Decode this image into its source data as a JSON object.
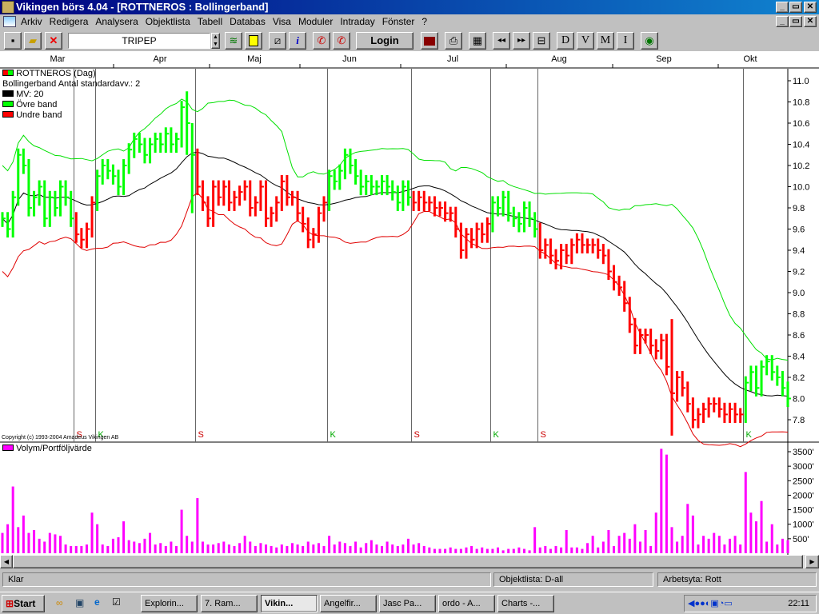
{
  "window": {
    "title": "Vikingen börs 4.04 - [ROTTNEROS : Bollingerband]",
    "min": "_",
    "restore": "▭",
    "close": "✕"
  },
  "menu": [
    "Arkiv",
    "Redigera",
    "Analysera",
    "Objektlista",
    "Tabell",
    "Databas",
    "Visa",
    "Moduler",
    "Intraday",
    "Fönster",
    "?"
  ],
  "toolbar": {
    "ticker": "TRIPEP",
    "login": "Login",
    "period_buttons": [
      "D",
      "V",
      "M",
      "I"
    ]
  },
  "chart": {
    "legend": {
      "title": "ROTTNEROS (Dag)",
      "subtitle": "Bollingerband  Antal standardavv.: 2",
      "ma": "MV: 20",
      "upper": "Övre band",
      "lower": "Undre band"
    },
    "copyright": "Copyright (c) 1993-2004 Amadeus Vikingen AB",
    "volume_label": "Volym/Portföljvärde"
  },
  "chart_data": {
    "type": "bar",
    "months": [
      "Mar",
      "Apr",
      "Maj",
      "Jun",
      "Jul",
      "Aug",
      "Sep",
      "Okt"
    ],
    "ylim": [
      7.6,
      11.12
    ],
    "yticks": [
      "11.0",
      "10.8",
      "10.6",
      "10.4",
      "10.2",
      "10.0",
      "9.8",
      "9.6",
      "9.4",
      "9.2",
      "9.0",
      "8.8",
      "8.6",
      "8.4",
      "8.2",
      "8.0",
      "7.8"
    ],
    "close": [
      9.7,
      9.6,
      9.9,
      10.3,
      10.2,
      9.8,
      9.9,
      10.0,
      9.7,
      9.9,
      9.8,
      10.0,
      9.9,
      9.7,
      9.55,
      9.5,
      9.6,
      9.85,
      10.1,
      10.2,
      10.15,
      10.1,
      10.0,
      10.2,
      10.35,
      10.45,
      10.4,
      10.3,
      10.4,
      10.45,
      10.4,
      10.5,
      10.4,
      10.45,
      10.75,
      10.6,
      10.3,
      10.0,
      9.85,
      9.7,
      10.0,
      9.9,
      10.0,
      9.85,
      9.9,
      9.95,
      10.0,
      9.8,
      9.85,
      10.0,
      9.7,
      9.75,
      9.85,
      10.05,
      9.9,
      9.9,
      9.75,
      9.65,
      9.5,
      9.55,
      9.75,
      9.85,
      10.1,
      10.05,
      10.15,
      10.3,
      10.2,
      10.1,
      10.0,
      10.05,
      10.0,
      10.0,
      10.05,
      10.0,
      9.95,
      9.85,
      10.0,
      9.9,
      9.85,
      9.9,
      9.85,
      9.85,
      9.8,
      9.8,
      9.75,
      9.75,
      9.6,
      9.4,
      9.55,
      9.5,
      9.6,
      9.55,
      9.65,
      9.85,
      9.8,
      9.9,
      9.75,
      9.7,
      9.65,
      9.8,
      9.7,
      9.6,
      9.4,
      9.45,
      9.35,
      9.3,
      9.4,
      9.35,
      9.45,
      9.5,
      9.45,
      9.45,
      9.45,
      9.4,
      9.35,
      9.2,
      9.1,
      9.05,
      8.9,
      8.7,
      8.5,
      8.6,
      8.6,
      8.5,
      8.45,
      8.55,
      8.3,
      8.05,
      8.2,
      8.1,
      7.95,
      7.8,
      7.85,
      7.9,
      7.95,
      7.95,
      7.9,
      7.85,
      7.9,
      7.85,
      7.85,
      8.15,
      8.25,
      8.1,
      8.3,
      8.35,
      8.25,
      8.2,
      8.1,
      8.0
    ],
    "spikes": [
      {
        "i": 35,
        "high": 10.9,
        "low": 10.3
      },
      {
        "i": 36,
        "high": 10.6,
        "low": 9.75
      },
      {
        "i": 127,
        "high": 8.75,
        "low": 7.65
      }
    ],
    "signals": [
      {
        "i": 14,
        "type": "S"
      },
      {
        "i": 18,
        "type": "K"
      },
      {
        "i": 37,
        "type": "S"
      },
      {
        "i": 62,
        "type": "K"
      },
      {
        "i": 78,
        "type": "S"
      },
      {
        "i": 93,
        "type": "K"
      },
      {
        "i": 102,
        "type": "S"
      },
      {
        "i": 141,
        "type": "K"
      }
    ],
    "ma_period": 20,
    "std_dev": 2,
    "volume_ticks": [
      "3500'",
      "3000'",
      "2500'",
      "2000'",
      "1500'",
      "1000'",
      "500'"
    ],
    "volume": [
      700,
      1000,
      2300,
      900,
      1300,
      700,
      800,
      500,
      400,
      700,
      650,
      600,
      300,
      250,
      250,
      250,
      300,
      1400,
      1000,
      300,
      250,
      500,
      550,
      1100,
      450,
      400,
      350,
      500,
      700,
      300,
      350,
      250,
      400,
      250,
      1500,
      600,
      400,
      1900,
      400,
      300,
      300,
      350,
      400,
      300,
      250,
      350,
      600,
      400,
      250,
      350,
      300,
      250,
      200,
      300,
      250,
      350,
      300,
      250,
      400,
      300,
      350,
      250,
      600,
      300,
      400,
      350,
      250,
      400,
      200,
      350,
      450,
      300,
      250,
      400,
      300,
      250,
      300,
      500,
      300,
      350,
      250,
      200,
      150,
      150,
      150,
      200,
      150,
      150,
      200,
      250,
      150,
      200,
      150,
      150,
      200,
      100,
      150,
      150,
      200,
      150,
      100,
      900,
      200,
      250,
      150,
      250,
      200,
      800,
      200,
      200,
      150,
      350,
      600,
      200,
      400,
      800,
      250,
      600,
      700,
      500,
      1000,
      400,
      800,
      250,
      1400,
      3600,
      3400,
      900,
      400,
      600,
      1700,
      1300,
      300,
      600,
      500,
      700,
      600,
      300,
      500,
      600,
      300,
      2800,
      1400,
      1100,
      1800,
      400,
      1000,
      300,
      500,
      450
    ],
    "colors": {
      "up": "#00ff00",
      "down": "#ff0000",
      "ma": "#000000",
      "volume": "#ff00ff"
    }
  },
  "status": {
    "left": "Klar",
    "middle": "Objektlista: D-all",
    "right": "Arbetsyta: Rott"
  },
  "taskbar": {
    "start": "Start",
    "tasks": [
      "Explorin...",
      "7. Ram...",
      "Vikin...",
      "Angelfir...",
      "Jasc Pa...",
      "ordo - A...",
      "Charts -..."
    ],
    "clock": "22:11"
  }
}
